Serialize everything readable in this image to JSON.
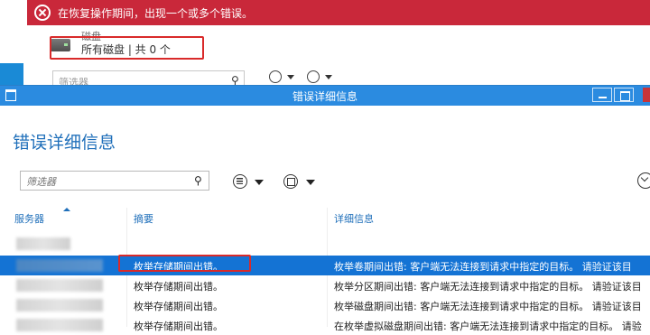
{
  "background_window": {
    "error_banner": "在恢复操作期间，出现一个或多个错误。",
    "disk_title": "磁盘",
    "disk_subtitle": "所有磁盘 | 共 0 个",
    "filter_placeholder": "筛选器"
  },
  "dialog": {
    "window_title": "错误详细信息",
    "heading": "错误详细信息",
    "filter_placeholder": "筛选器",
    "columns": {
      "server": "服务器",
      "summary": "摘要",
      "details": "详细信息"
    },
    "rows": [
      {
        "summary": "枚举存储期间出错。",
        "details": "枚举卷期间出错: 客户端无法连接到请求中指定的目标。 请验证该目",
        "selected": true
      },
      {
        "summary": "枚举存储期间出错。",
        "details": "枚举分区期间出错: 客户端无法连接到请求中指定的目标。 请验证该目"
      },
      {
        "summary": "枚举存储期间出错。",
        "details": "枚举磁盘期间出错: 客户端无法连接到请求中指定的目标。 请验证该目"
      },
      {
        "summary": "枚举存储期间出错。",
        "details": "在枚举虚拟磁盘期间出错: 客户端无法连接到请求中指定的目标。 请验"
      }
    ]
  },
  "colors": {
    "accent": "#2b8be0",
    "error": "#c9283a",
    "selection": "#1473d4",
    "highlight_box": "#d92a2a"
  }
}
